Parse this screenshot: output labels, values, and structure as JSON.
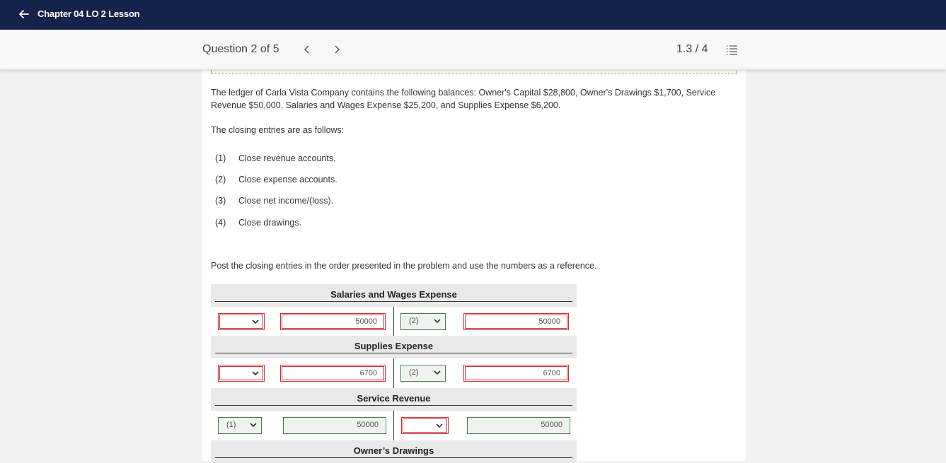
{
  "topbar": {
    "title": "Chapter 04 LO 2 Lesson"
  },
  "question_bar": {
    "label": "Question 2 of 5",
    "prev": "<",
    "next": ">",
    "score": "1.3 / 4"
  },
  "problem": {
    "intro": "The ledger of Carla Vista Company contains the following balances: Owner's Capital $28,800, Owner's Drawings $1,700, Service Revenue $50,000, Salaries and Wages Expense $25,200, and Supplies Expense $6,200.",
    "closing_intro": "The closing entries are as follows:",
    "steps": [
      {
        "num": "(1)",
        "text": "Close revenue accounts."
      },
      {
        "num": "(2)",
        "text": "Close expense accounts."
      },
      {
        "num": "(3)",
        "text": "Close net income/(loss)."
      },
      {
        "num": "(4)",
        "text": "Close drawings."
      }
    ],
    "instruction": "Post the closing entries in the order presented in the problem and use the numbers as a reference."
  },
  "accounts": [
    {
      "title": "Salaries and Wages Expense",
      "debit_ref": "",
      "debit_amount": "50000",
      "credit_ref": "(2)",
      "credit_amount": "50000"
    },
    {
      "title": "Supplies Expense",
      "debit_ref": "",
      "debit_amount": "6700",
      "credit_ref": "(2)",
      "credit_amount": "6700"
    },
    {
      "title": "Service Revenue",
      "debit_ref": "(1)",
      "debit_amount": "50000",
      "credit_ref": "",
      "credit_amount": "50000"
    },
    {
      "title": "Owner’s Drawings"
    }
  ],
  "colors": {
    "header_bg": "#15234a",
    "error": "#cc3333",
    "correct": "#3f7f3f"
  }
}
